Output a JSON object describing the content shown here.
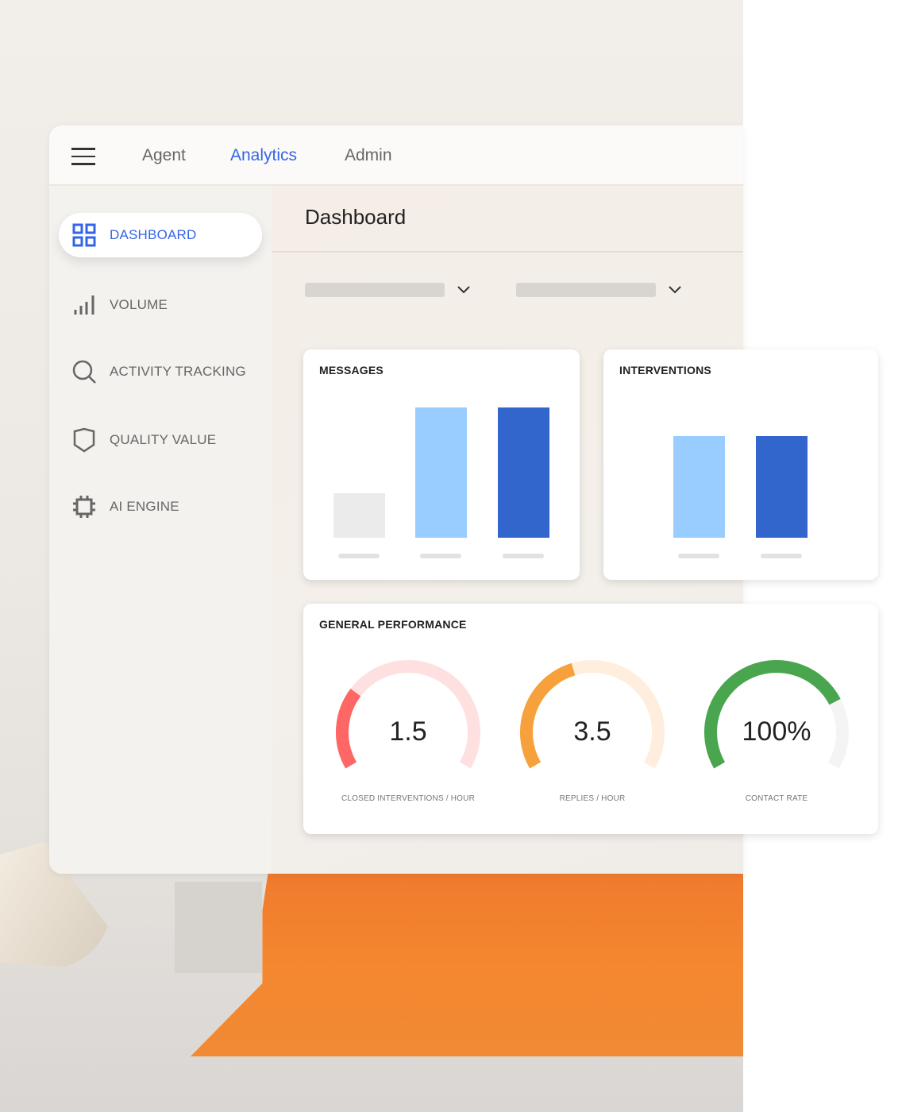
{
  "topnav": {
    "menu_icon": "hamburger-icon",
    "tabs": [
      {
        "label": "Agent",
        "active": false
      },
      {
        "label": "Analytics",
        "active": true
      },
      {
        "label": "Admin",
        "active": false
      }
    ]
  },
  "sidebar": {
    "items": [
      {
        "label": "DASHBOARD",
        "icon": "grid-icon",
        "active": true
      },
      {
        "label": "VOLUME",
        "icon": "bar-signal-icon",
        "active": false
      },
      {
        "label": "ACTIVITY TRACKING",
        "icon": "search-icon",
        "active": false
      },
      {
        "label": "QUALITY VALUE",
        "icon": "shield-icon",
        "active": false
      },
      {
        "label": "AI ENGINE",
        "icon": "chip-icon",
        "active": false
      }
    ]
  },
  "main": {
    "title": "Dashboard"
  },
  "colors": {
    "accent": "#3366e6",
    "bar_gray": "#ebebeb",
    "bar_light": "#99ccff",
    "bar_dark": "#3366cc",
    "red": "#ff6666",
    "red_track": "#ffe0e0",
    "orange": "#f7a13c",
    "orange_track": "#ffeedd",
    "green": "#4aa54f",
    "green_track": "#f4f4f4"
  },
  "chart_data": [
    {
      "type": "bar",
      "title": "MESSAGES",
      "categories": [
        "",
        "",
        ""
      ],
      "values": [
        34,
        100,
        100
      ],
      "colors": [
        "#ebebeb",
        "#99ccff",
        "#3366cc"
      ]
    },
    {
      "type": "bar",
      "title": "INTERVENTIONS",
      "categories": [
        "",
        ""
      ],
      "values": [
        78,
        78
      ],
      "colors": [
        "#99ccff",
        "#3366cc"
      ]
    }
  ],
  "performance": {
    "title": "GENERAL PERFORMANCE",
    "gauges": [
      {
        "value": "1.5",
        "caption": "CLOSED INTERVENTIONS / HOUR",
        "fill": 0.28,
        "color": "#ff6666",
        "track": "#ffe0e0"
      },
      {
        "value": "3.5",
        "caption": "REPLIES / HOUR",
        "fill": 0.43,
        "color": "#f7a13c",
        "track": "#ffeedd"
      },
      {
        "value": "100%",
        "caption": "CONTACT RATE",
        "fill": 0.76,
        "color": "#4aa54f",
        "track": "#f4f4f4"
      }
    ]
  }
}
